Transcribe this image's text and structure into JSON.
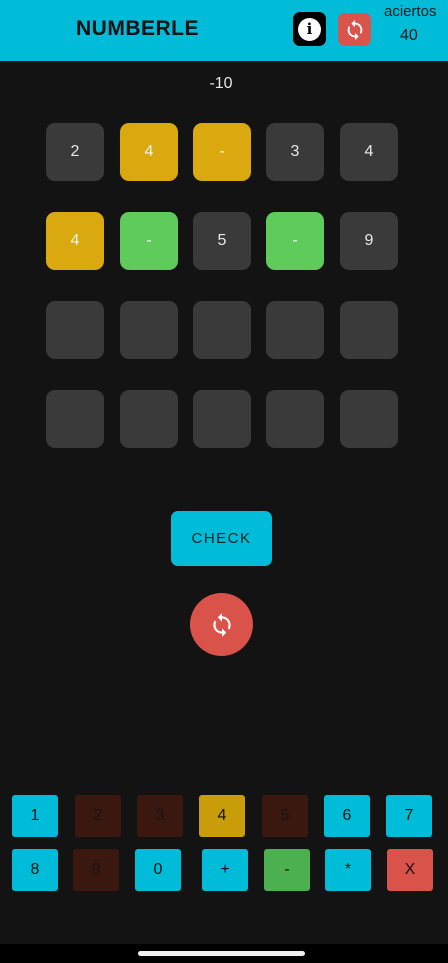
{
  "app": {
    "title": "NUMBERLE",
    "score_label": "aciertos",
    "score_value": "40",
    "info_glyph": "i"
  },
  "target": "-10",
  "grid": {
    "rows": [
      [
        "2",
        "4",
        "-",
        "3",
        "4"
      ],
      [
        "4",
        "-",
        "5",
        "-",
        "9"
      ],
      [
        "",
        "",
        "",
        "",
        ""
      ],
      [
        "",
        "",
        "",
        "",
        ""
      ]
    ],
    "states": [
      [
        "gray",
        "yellow",
        "yellow",
        "gray",
        "gray"
      ],
      [
        "yellow",
        "green",
        "gray",
        "green",
        "gray"
      ],
      [
        "empty",
        "empty",
        "empty",
        "empty",
        "empty"
      ],
      [
        "empty",
        "empty",
        "empty",
        "empty",
        "empty"
      ]
    ]
  },
  "check_label": "CHECK",
  "keyboard": {
    "row1": [
      {
        "label": "1",
        "state": "cyan"
      },
      {
        "label": "2",
        "state": "brown"
      },
      {
        "label": "3",
        "state": "brown"
      },
      {
        "label": "4",
        "state": "gold"
      },
      {
        "label": "5",
        "state": "brown"
      },
      {
        "label": "6",
        "state": "cyan"
      },
      {
        "label": "7",
        "state": "cyan"
      }
    ],
    "row2": [
      {
        "label": "8",
        "state": "cyan"
      },
      {
        "label": "9",
        "state": "brown"
      },
      {
        "label": "0",
        "state": "cyan"
      },
      {
        "label": "+",
        "state": "cyan"
      },
      {
        "label": "-",
        "state": "green"
      },
      {
        "label": "*",
        "state": "cyan"
      },
      {
        "label": "X",
        "state": "red"
      }
    ]
  },
  "icons": {
    "info": "info-icon",
    "refresh": "refresh-icon"
  },
  "colors": {
    "accent": "#00bcd9",
    "background": "#131313",
    "tile_gray": "#3a3a3a",
    "tile_yellow": "#d9a90f",
    "tile_green": "#5ecb5a",
    "refresh_red": "#d9534a",
    "key_gold": "#c99c0a",
    "key_brown": "#3b180f"
  }
}
